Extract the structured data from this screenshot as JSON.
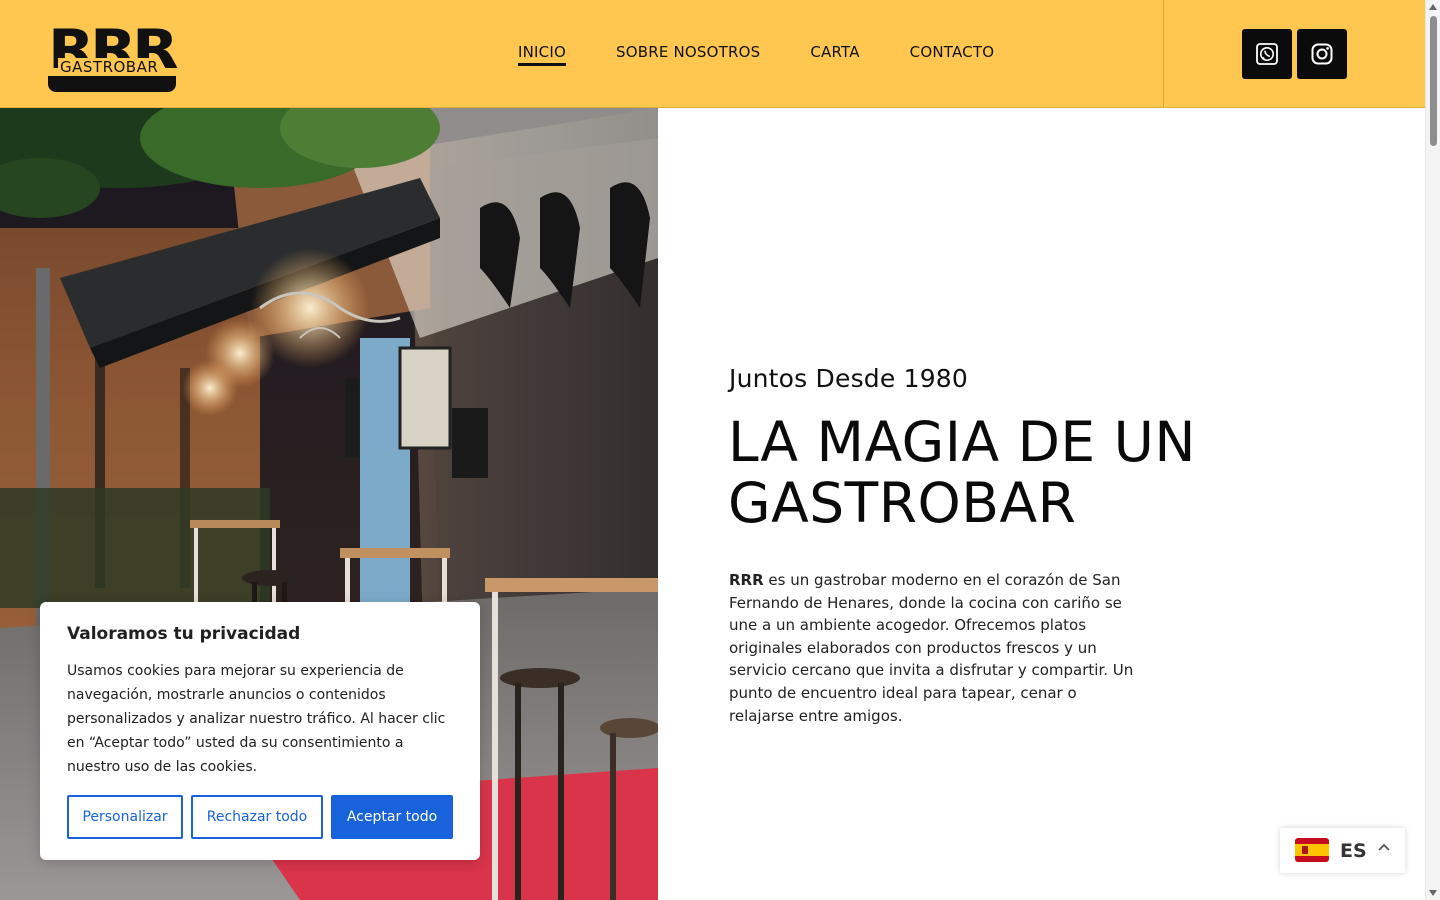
{
  "brand": {
    "logo_letters": "RRR",
    "logo_subtitle": "GASTROBAR",
    "accent_color": "#ffc74f"
  },
  "nav": {
    "items": [
      {
        "label": "INICIO",
        "active": true
      },
      {
        "label": "SOBRE NOSOTROS",
        "active": false
      },
      {
        "label": "CARTA",
        "active": false
      },
      {
        "label": "CONTACTO",
        "active": false
      }
    ]
  },
  "social": {
    "whatsapp_icon": "whatsapp-icon",
    "instagram_icon": "instagram-icon"
  },
  "hero": {
    "eyebrow": "Juntos Desde 1980",
    "headline_line1": "LA MAGIA DE UN",
    "headline_line2": "GASTROBAR",
    "body_strong": "RRR",
    "body_rest": " es un gastrobar moderno en el corazón de San Fernando de Henares, donde la cocina con cariño se une a un ambiente acogedor. Ofrecemos platos originales elaborados con productos frescos y un servicio cercano que invita a disfrutar y compartir. Un punto de encuentro ideal para tapear, cenar o relajarse entre amigos."
  },
  "cookie": {
    "title": "Valoramos tu privacidad",
    "text": "Usamos cookies para mejorar su experiencia de navegación, mostrarle anuncios o contenidos personalizados y analizar nuestro tráfico. Al hacer clic en “Aceptar todo” usted da su consentimiento a nuestro uso de las cookies.",
    "customize_label": "Personalizar",
    "reject_label": "Rechazar todo",
    "accept_label": "Aceptar todo",
    "button_color": "#1863dc"
  },
  "language": {
    "code": "ES",
    "flag_icon": "spain-flag-icon"
  }
}
